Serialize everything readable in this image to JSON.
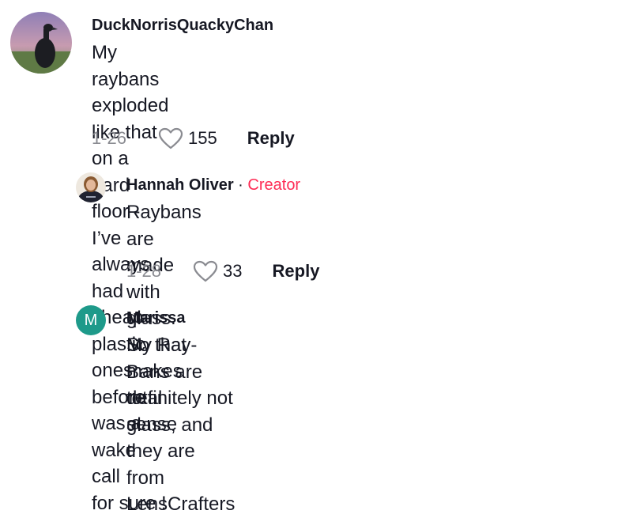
{
  "comments": [
    {
      "username": "DuckNorrisQuackyChan",
      "text_lines": [
        "My raybans exploded like that on a hard floor - I’ve",
        "always had cheap plastic ones before was a wake call",
        "for sure !"
      ],
      "date": "1-26",
      "likes": "155",
      "reply_label": "Reply"
    },
    {
      "username": "Hannah Oliver",
      "separator": "·",
      "badge": "Creator",
      "text_lines": [
        "Raybans are made with glass. So that makes total",
        "sense"
      ],
      "date": "1-28",
      "likes": "33",
      "reply_label": "Reply"
    },
    {
      "username": "Marissa",
      "avatar_initial": "M",
      "text_lines": [
        "My Ray-Bans are definitely not glass, and they are",
        "from LensCrafters"
      ]
    }
  ],
  "colors": {
    "creator_badge": "#fe2c55",
    "avatar_m_bg": "#1e9a8a",
    "meta_gray": "#8a8b91"
  }
}
